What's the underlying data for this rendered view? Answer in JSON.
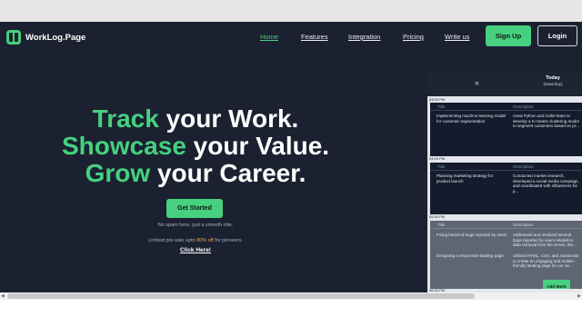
{
  "brand": {
    "name": "WorkLog.Page"
  },
  "nav": {
    "links": [
      "Home",
      "Features",
      "Integration",
      "Pricing",
      "Write us"
    ],
    "signup": "Sign Up",
    "login": "Login"
  },
  "hero": {
    "line1_accent": "Track",
    "line1_rest": " your Work.",
    "line2_accent": "Showcase",
    "line2_rest": " your Value.",
    "line3_accent": "Grow",
    "line3_rest": " your Career.",
    "cta": "Get Started",
    "no_spam": "No spam here, just a smooth ride.",
    "presale_pre": "Limited pre-sale upto ",
    "presale_off": "80% off",
    "presale_post": " for pioneers.",
    "click_here": "Click Here!"
  },
  "panel": {
    "prev": "«",
    "day": "Today",
    "date": "(Saturday)",
    "times": [
      "03:00 PM",
      "04:00 PM",
      "05:00 PM",
      "06:00 PM"
    ],
    "col_title": "Title",
    "col_desc": "Description",
    "slots": [
      {
        "title": "Implementing machine learning model for customer segmentation",
        "desc": "Used Python and Scikit-learn to develop a K-means clustering model to segment customers based on pr..."
      },
      {
        "title": "Planning marketing strategy for product launch",
        "desc": "Conducted market research, developed a social media campaign, and coordinated with influencers for p..."
      },
      {
        "title": "Fixing backend bugs reported by users",
        "desc": "Addressed and resolved several bugs reported by users related to data retrieval from the server, the..."
      },
      {
        "title": "Designing a responsive landing page",
        "desc": "Utilized HTML, CSS, and JavaScript to create an engaging and mobile-friendly landing page for our ne..."
      }
    ],
    "add_work": "Add Work"
  },
  "colors": {
    "accent": "#46d07f",
    "background": "#1b2130",
    "highlight": "#f2a43a"
  }
}
